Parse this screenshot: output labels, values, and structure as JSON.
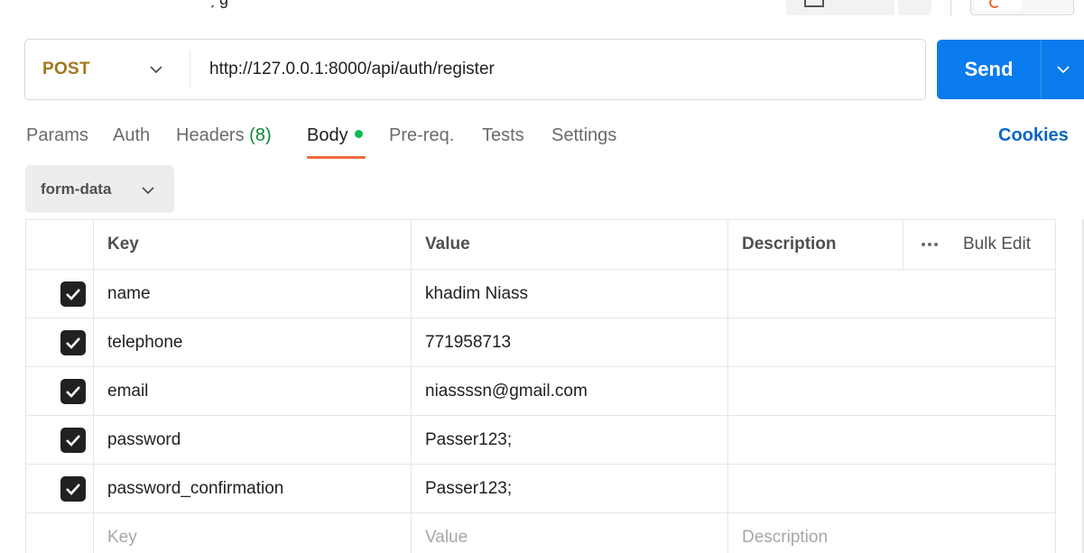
{
  "request": {
    "method": "POST",
    "url": "http://127.0.0.1:8000/api/auth/register",
    "send_label": "Send"
  },
  "tabs": [
    {
      "label": "Params"
    },
    {
      "label": "Auth"
    },
    {
      "label": "Headers",
      "count": "(8)"
    },
    {
      "label": "Body",
      "active": true,
      "indicator": "green-dot"
    },
    {
      "label": "Pre-req."
    },
    {
      "label": "Tests"
    },
    {
      "label": "Settings"
    }
  ],
  "cookies_label": "Cookies",
  "body_type": "form-data",
  "table": {
    "headers": {
      "key": "Key",
      "value": "Value",
      "description": "Description",
      "bulk_edit": "Bulk Edit"
    },
    "rows": [
      {
        "checked": true,
        "key": "name",
        "value": "khadim Niass",
        "description": ""
      },
      {
        "checked": true,
        "key": "telephone",
        "value": "771958713",
        "description": ""
      },
      {
        "checked": true,
        "key": "email",
        "value": "niassssn@gmail.com",
        "description": ""
      },
      {
        "checked": true,
        "key": "password",
        "value": "Passer123;",
        "description": ""
      },
      {
        "checked": true,
        "key": "password_confirmation",
        "value": "Passer123;",
        "description": ""
      }
    ],
    "placeholder_row": {
      "key": "Key",
      "value": "Value",
      "description": "Description"
    }
  },
  "colors": {
    "send": "#097bed",
    "method": "#a2781b",
    "active_underline": "#f26b3a",
    "body_dot": "#0cbb52",
    "cookies": "#0b66c3"
  },
  "icons": [
    "back-arrow-icon",
    "chevron-down-icon",
    "check-icon",
    "more-dots-icon"
  ]
}
